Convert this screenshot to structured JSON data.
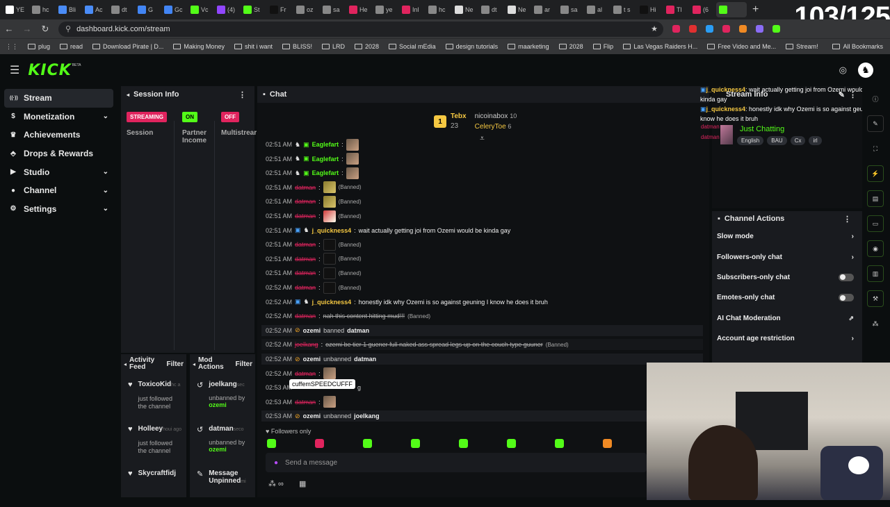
{
  "browser": {
    "tabs": [
      {
        "label": "YE",
        "color": "#ffffff"
      },
      {
        "label": "hc",
        "color": "#888888"
      },
      {
        "label": "Bli",
        "color": "#4a8cf7"
      },
      {
        "label": "Ac",
        "color": "#4a8cf7"
      },
      {
        "label": "dt",
        "color": "#888888"
      },
      {
        "label": "G",
        "color": "#4285f4"
      },
      {
        "label": "Gc",
        "color": "#4285f4"
      },
      {
        "label": "Vc",
        "color": "#53fc18"
      },
      {
        "label": "(4)",
        "color": "#9146ff"
      },
      {
        "label": "St",
        "color": "#53fc18"
      },
      {
        "label": "Fr",
        "color": "#111111"
      },
      {
        "label": "oz",
        "color": "#888888"
      },
      {
        "label": "sa",
        "color": "#888888"
      },
      {
        "label": "He",
        "color": "#e0245e"
      },
      {
        "label": "ye",
        "color": "#888888"
      },
      {
        "label": "Inl",
        "color": "#e0245e"
      },
      {
        "label": "hc",
        "color": "#888888"
      },
      {
        "label": "Ne",
        "color": "#dddddd"
      },
      {
        "label": "dt",
        "color": "#888888"
      },
      {
        "label": "Ne",
        "color": "#dddddd"
      },
      {
        "label": "ar",
        "color": "#888888"
      },
      {
        "label": "sa",
        "color": "#888888"
      },
      {
        "label": "al",
        "color": "#888888"
      },
      {
        "label": "t s",
        "color": "#888888"
      },
      {
        "label": "Hi",
        "color": "#111111"
      },
      {
        "label": "Tl",
        "color": "#e0245e"
      },
      {
        "label": "(6",
        "color": "#e0245e"
      },
      {
        "label": "",
        "color": "#53fc18"
      }
    ],
    "tab_counter": "103/125",
    "url": "dashboard.kick.com/stream",
    "bookmarks": [
      "plug",
      "read",
      "Download Pirate | D...",
      "Making Money",
      "shit i want",
      "BLISS!",
      "LRD",
      "2028",
      "Social mEdia",
      "design tutorials",
      "maarketing",
      "2028",
      "Flip",
      "Las Vegas Raiders H...",
      "Free Video and Me...",
      "Stream!"
    ],
    "all_bookmarks": "All Bookmarks"
  },
  "kick": {
    "logo": "KICK",
    "beta": "BETA"
  },
  "nav": {
    "items": [
      {
        "label": "Stream",
        "icon": "broadcast-icon",
        "chev": ""
      },
      {
        "label": "Monetization",
        "icon": "dollar-icon",
        "chev": "⌄"
      },
      {
        "label": "Achievements",
        "icon": "trophy-icon",
        "chev": ""
      },
      {
        "label": "Drops & Rewards",
        "icon": "gift-icon",
        "chev": ""
      },
      {
        "label": "Studio",
        "icon": "play-icon",
        "chev": "⌄"
      },
      {
        "label": "Channel",
        "icon": "user-icon",
        "chev": "⌄"
      },
      {
        "label": "Settings",
        "icon": "gear-icon",
        "chev": "⌄"
      }
    ]
  },
  "session": {
    "title": "Session Info",
    "streaming": "STREAMING",
    "session_label": "Session",
    "on": "ON",
    "partner": "Partner Income",
    "off": "OFF",
    "multistream": "Multistrear"
  },
  "activity": {
    "title": "Activity Feed",
    "filter": "Filter",
    "items": [
      {
        "name": "ToxicoKid",
        "meta": "hc a",
        "text": "just followed the channel"
      },
      {
        "name": "Holleey",
        "meta": "houi ago",
        "text": "just followed the channel"
      },
      {
        "name": "Skycraftfidj",
        "meta": "",
        "text": ""
      }
    ]
  },
  "modactions": {
    "title": "Mod Actions",
    "filter": "Filter",
    "items": [
      {
        "name": "joelkang",
        "meta": "sec",
        "text": "unbanned by",
        "by": "ozemi"
      },
      {
        "name": "datman",
        "meta": "seco",
        "text": "unbanned by",
        "by": "ozemi"
      },
      {
        "name": "Message Unpinned",
        "meta": "mi",
        "text": "",
        "by": ""
      }
    ]
  },
  "chat": {
    "title": "Chat",
    "leaderboard": [
      {
        "rank": "1",
        "name": "Tebx",
        "count": "23",
        "name2": "nicoinabox",
        "count2": "10",
        "name3": "CeleryToe",
        "count3": "6"
      }
    ],
    "messages": [
      {
        "ts": "02:51 AM",
        "user": "Eaglefart",
        "style": "green",
        "text": "",
        "tail": ""
      },
      {
        "ts": "02:51 AM",
        "user": "Eaglefart",
        "style": "green",
        "text": "",
        "tail": ""
      },
      {
        "ts": "02:51 AM",
        "user": "Eaglefart",
        "style": "green",
        "text": "",
        "tail": ""
      },
      {
        "ts": "02:51 AM",
        "user": "datman",
        "style": "red",
        "text": "",
        "tail": "(Banned)"
      },
      {
        "ts": "02:51 AM",
        "user": "datman",
        "style": "red",
        "text": "",
        "tail": "(Banned)"
      },
      {
        "ts": "02:51 AM",
        "user": "datman",
        "style": "red",
        "text": "",
        "tail": "(Banned)"
      },
      {
        "ts": "02:51 AM",
        "user": "j_quickness4",
        "style": "yel",
        "text": "wait actually getting joi from Ozemi would be kinda gay",
        "tail": ""
      },
      {
        "ts": "02:51 AM",
        "user": "datman",
        "style": "red",
        "text": "",
        "tail": "(Banned)"
      },
      {
        "ts": "02:51 AM",
        "user": "datman",
        "style": "red",
        "text": "",
        "tail": "(Banned)"
      },
      {
        "ts": "02:51 AM",
        "user": "datman",
        "style": "red",
        "text": "",
        "tail": "(Banned)"
      },
      {
        "ts": "02:52 AM",
        "user": "datman",
        "style": "red",
        "text": "",
        "tail": "(Banned)"
      },
      {
        "ts": "02:52 AM",
        "user": "j_quickness4",
        "style": "yel",
        "text": "honestly idk why Ozemi is so against geuning I know he does it bruh",
        "tail": ""
      },
      {
        "ts": "02:52 AM",
        "user": "datman",
        "style": "red",
        "text": "nah this content hitting mud!!!",
        "tail": "(Banned)"
      },
      {
        "ts": "02:52 AM",
        "user": "ozemi",
        "style": "sys",
        "text": "banned",
        "tail": "datman"
      },
      {
        "ts": "02:52 AM",
        "user": "joelkang",
        "style": "red",
        "text": "ozemi be tier 1 guener full naked ass spread legs up on the couch type guuner",
        "tail": "(Banned)"
      },
      {
        "ts": "02:52 AM",
        "user": "ozemi",
        "style": "sys",
        "text": "unbanned",
        "tail": "datman"
      },
      {
        "ts": "02:52 AM",
        "user": "datman",
        "style": "red",
        "text": "",
        "tail": ""
      },
      {
        "ts": "02:53 AM",
        "user": "",
        "style": "none",
        "text": "",
        "tail": "g"
      },
      {
        "ts": "02:53 AM",
        "user": "datman",
        "style": "red",
        "text": "",
        "tail": ""
      },
      {
        "ts": "02:53 AM",
        "user": "ozemi",
        "style": "sys",
        "text": "unbanned",
        "tail": "joelkang"
      }
    ],
    "tooltip": "cuffemSPEEDCUFFF",
    "followers_only": "Followers only",
    "placeholder": "Send a message"
  },
  "overlay_chat": [
    {
      "user": "j_quickness4",
      "text": ": wait actually getting joi from Ozemi would be kinda gay"
    },
    {
      "user": "j_quickness4",
      "text": ": honestly idk why Ozemi is so against geuning I know he does it bruh"
    }
  ],
  "streaminfo": {
    "title": "Stream Info",
    "category": "Just Chatting",
    "tags": [
      "English",
      "BAU",
      "Cx",
      "irl"
    ],
    "overlay_red": "datman",
    "overlay_red2": "datman"
  },
  "channel_actions": {
    "title": "Channel Actions",
    "items": [
      {
        "label": "Slow mode",
        "ctrl": "chevron"
      },
      {
        "label": "Followers-only chat",
        "ctrl": "chevron"
      },
      {
        "label": "Subscribers-only chat",
        "ctrl": "toggle"
      },
      {
        "label": "Emotes-only chat",
        "ctrl": "toggle"
      },
      {
        "label": "AI Chat Moderation",
        "ctrl": "external"
      },
      {
        "label": "Account age restriction",
        "ctrl": "chevron"
      }
    ]
  }
}
